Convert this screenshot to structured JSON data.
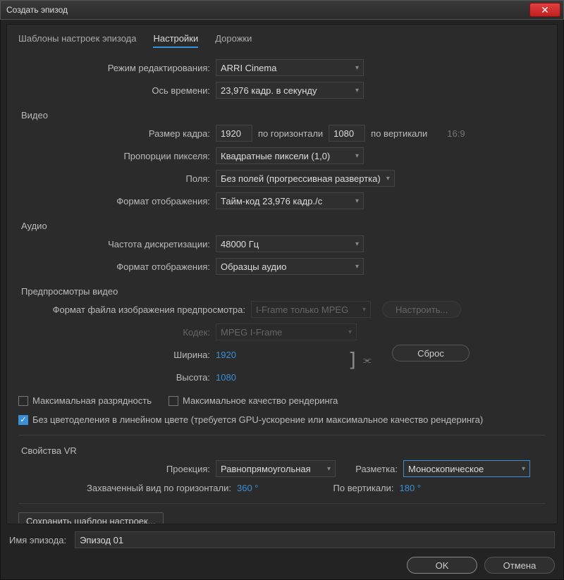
{
  "window": {
    "title": "Создать эпизод"
  },
  "tabs": {
    "presets": "Шаблоны настроек эпизода",
    "settings": "Настройки",
    "tracks": "Дорожки"
  },
  "general": {
    "editing_mode_label": "Режим редактирования:",
    "editing_mode_value": "ARRI Cinema",
    "timebase_label": "Ось времени:",
    "timebase_value": "23,976  кадр. в секунду"
  },
  "video": {
    "section": "Видео",
    "frame_size_label": "Размер кадра:",
    "frame_w": "1920",
    "horiz": "по горизонтали",
    "frame_h": "1080",
    "vert": "по вертикали",
    "aspect": "16:9",
    "pixel_aspect_label": "Пропорции пикселя:",
    "pixel_aspect_value": "Квадратные пиксели (1,0)",
    "fields_label": "Поля:",
    "fields_value": "Без полей (прогрессивная развертка)",
    "display_format_label": "Формат отображения:",
    "display_format_value": "Тайм-код 23,976 кадр./с"
  },
  "audio": {
    "section": "Аудио",
    "sample_rate_label": "Частота дискретизации:",
    "sample_rate_value": "48000 Гц",
    "display_format_label": "Формат отображения:",
    "display_format_value": "Образцы аудио"
  },
  "preview": {
    "section": "Предпросмотры видео",
    "file_format_label": "Формат файла изображения предпросмотра:",
    "file_format_value": "I-Frame только MPEG",
    "configure": "Настроить...",
    "codec_label": "Кодек:",
    "codec_value": "MPEG I-Frame",
    "width_label": "Ширина:",
    "width_value": "1920",
    "height_label": "Высота:",
    "height_value": "1080",
    "reset": "Сброс",
    "max_bit_depth": "Максимальная разрядность",
    "max_render_quality": "Максимальное качество рендеринга",
    "linear_color": "Без цветоделения в линейном цвете (требуется GPU-ускорение или максимальное качество рендеринга)"
  },
  "vr": {
    "section": "Свойства VR",
    "projection_label": "Проекция:",
    "projection_value": "Равнопрямоугольная",
    "layout_label": "Разметка:",
    "layout_value": "Моноскопическое",
    "captured_h_label": "Захваченный вид по горизонтали:",
    "captured_h_value": "360 °",
    "captured_v_label": "По вертикали:",
    "captured_v_value": "180 °"
  },
  "save_preset": "Сохранить шаблон настроек...",
  "sequence_name_label": "Имя эпизода:",
  "sequence_name_value": "Эпизод 01",
  "buttons": {
    "ok": "OK",
    "cancel": "Отмена"
  }
}
